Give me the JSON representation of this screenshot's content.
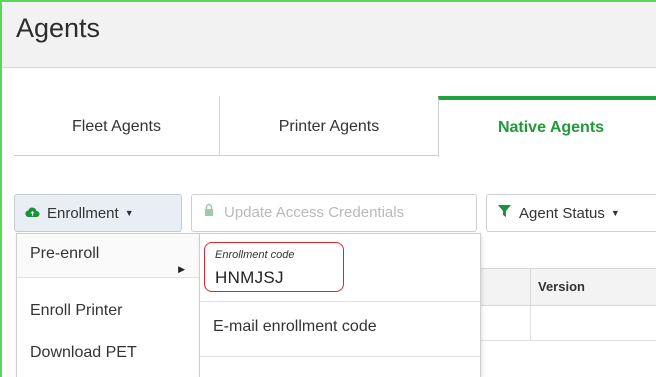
{
  "header": {
    "title": "Agents"
  },
  "tabs": [
    {
      "label": "Fleet Agents"
    },
    {
      "label": "Printer Agents"
    },
    {
      "label": "Native Agents"
    }
  ],
  "toolbar": {
    "enrollment_label": "Enrollment",
    "update_label": "Update Access Credentials",
    "status_label": "Agent Status"
  },
  "grid": {
    "version_header": "Version"
  },
  "enrollment_menu": {
    "items": [
      {
        "label": "Pre-enroll"
      },
      {
        "label": "Enroll Printer"
      },
      {
        "label": "Download PET"
      }
    ]
  },
  "pre_enroll_submenu": {
    "code_label": "Enrollment code",
    "code_value": "HNMJSJ",
    "email_label": "E-mail enrollment code"
  },
  "colors": {
    "accent_green": "#1ea33c",
    "highlight_red": "#d8262b"
  }
}
